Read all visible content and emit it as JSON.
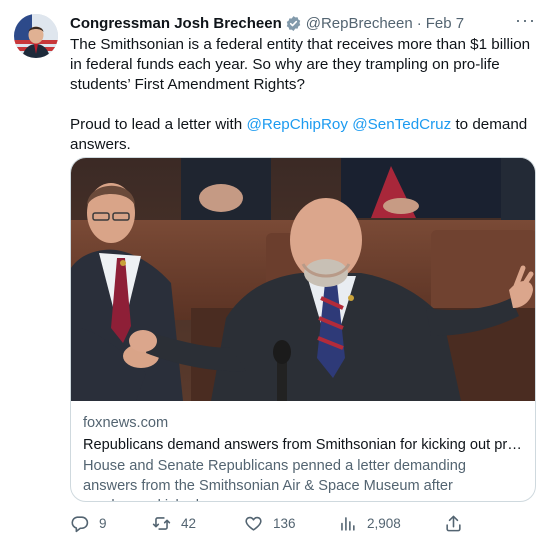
{
  "tweet": {
    "author_name": "Congressman Josh Brecheen",
    "handle": "@RepBrecheen",
    "separator": "·",
    "date": "Feb 7",
    "more_label": "···",
    "text_line1": "The Smithsonian is a federal entity that receives more than $1 billion in federal funds each year. So why are they trampling on pro-life students’ First Amendment Rights?",
    "text2_start": "Proud to lead a letter with ",
    "mention1": "@RepChipRoy",
    "mention2": "@SenTedCruz",
    "text2_end": " to demand answers."
  },
  "card": {
    "domain": "foxnews.com",
    "title": "Republicans demand answers from Smithsonian for kicking out pro-...",
    "description": "House and Senate Republicans penned a letter demanding answers from the Smithsonian Air & Space Museum after employees kicked ..."
  },
  "actions": {
    "replies": "9",
    "retweets": "42",
    "likes": "136",
    "views": "2,908"
  },
  "icons": {
    "verified": "verified-badge-icon",
    "reply": "reply-icon",
    "retweet": "retweet-icon",
    "like": "heart-icon",
    "views": "views-icon",
    "share": "share-icon"
  },
  "colors": {
    "link": "#1d9bf0",
    "secondary_text": "#536471",
    "primary_text": "#0f1419",
    "border": "#cfd9de"
  }
}
